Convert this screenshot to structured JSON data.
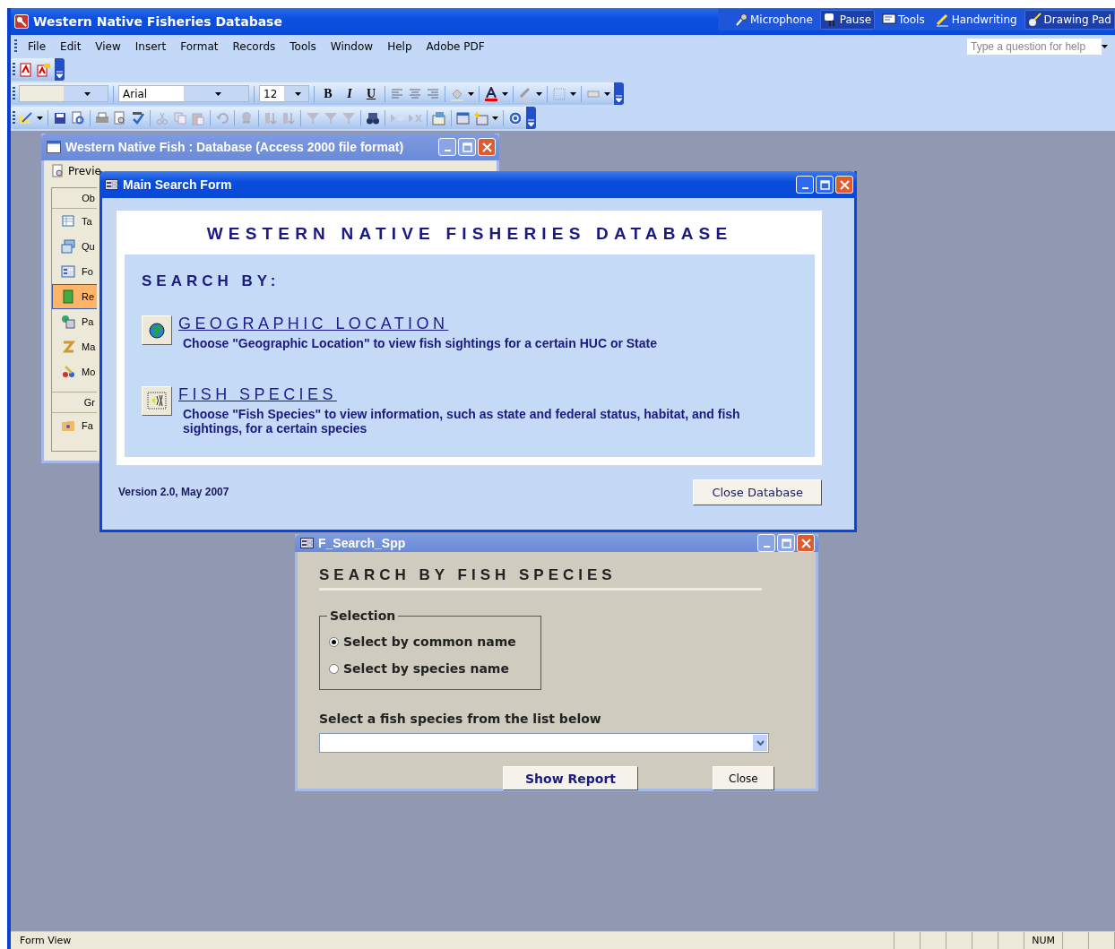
{
  "app_title": "Western Native Fisheries Database",
  "language_bar": [
    {
      "label": "Microphone",
      "selected": false
    },
    {
      "label": "Pause",
      "selected": true
    },
    {
      "label": "Tools",
      "selected": false
    },
    {
      "label": "Handwriting",
      "selected": false
    },
    {
      "label": "Drawing Pad",
      "selected": true
    }
  ],
  "menu": [
    "File",
    "Edit",
    "View",
    "Insert",
    "Format",
    "Records",
    "Tools",
    "Window",
    "Help",
    "Adobe PDF"
  ],
  "help_box": {
    "placeholder": "Type a question for help"
  },
  "formatting": {
    "font": "Arial",
    "size": "12",
    "buttons": [
      "B",
      "I",
      "U"
    ]
  },
  "database_window": {
    "title": "Western Native Fish : Database (Access 2000 file format)",
    "toolbar_button": "Previe",
    "objects_header": "Ob",
    "objects": [
      {
        "label": "Ta",
        "selected": false
      },
      {
        "label": "Qu",
        "selected": false
      },
      {
        "label": "Fo",
        "selected": false
      },
      {
        "label": "Re",
        "selected": true
      },
      {
        "label": "Pa",
        "selected": false
      },
      {
        "label": "Ma",
        "selected": false
      },
      {
        "label": "Mo",
        "selected": false
      }
    ],
    "groups_header": "Gr",
    "groups": [
      "Fa"
    ]
  },
  "main_search_form": {
    "title": "Main Search Form",
    "heading": "WESTERN NATIVE FISHERIES DATABASE",
    "search_by": "SEARCH BY:",
    "options": [
      {
        "title": "GEOGRAPHIC LOCATION",
        "description": "Choose \"Geographic Location\" to view fish sightings for a certain HUC or State"
      },
      {
        "title": "FISH SPECIES",
        "description": "Choose \"Fish Species\" to view information, such as state and federal status, habitat, and fish sightings, for a certain species"
      }
    ],
    "version": "Version 2.0, May 2007",
    "close_button": "Close Database"
  },
  "search_spp": {
    "title": "F_Search_Spp",
    "heading": "SEARCH BY FISH SPECIES",
    "group_label": "Selection",
    "radios": [
      {
        "label": "Select by common name",
        "selected": true
      },
      {
        "label": "Select by species name",
        "selected": false
      }
    ],
    "list_label": "Select a fish species from the list below",
    "show_report": "Show Report",
    "close": "Close"
  },
  "status_bar": {
    "text": "Form View",
    "indicators": [
      "NUM"
    ]
  }
}
